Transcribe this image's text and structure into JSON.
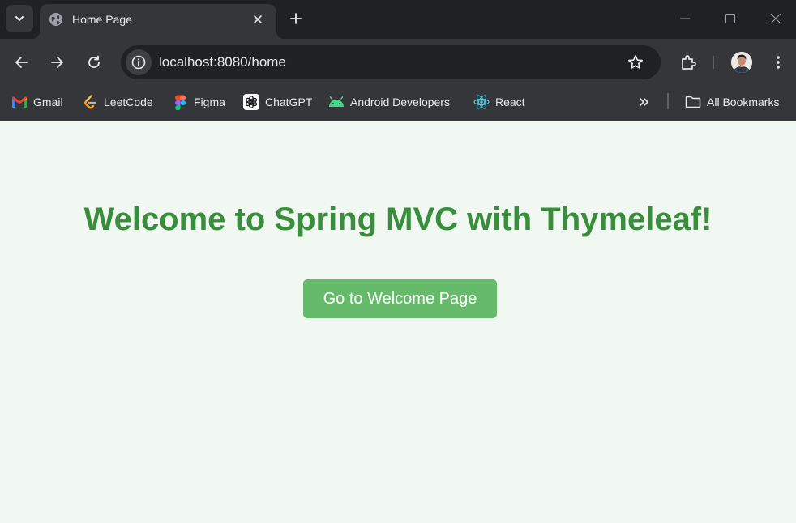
{
  "browser": {
    "tab": {
      "title": "Home Page",
      "favicon": "globe-icon"
    },
    "new_tab_icon": "plus-icon",
    "window_controls": [
      "minimize-icon",
      "maximize-icon",
      "close-icon"
    ],
    "address_bar": {
      "url": "localhost:8080/home",
      "site_info_icon": "info-icon",
      "bookmark_icon": "star-icon"
    }
  },
  "bookmarks": {
    "items": [
      {
        "label": "Gmail",
        "icon": "gmail-icon"
      },
      {
        "label": "LeetCode",
        "icon": "leetcode-icon"
      },
      {
        "label": "Figma",
        "icon": "figma-icon"
      },
      {
        "label": "ChatGPT",
        "icon": "chatgpt-icon"
      },
      {
        "label": "Android Developers",
        "icon": "android-icon"
      },
      {
        "label": "React",
        "icon": "react-icon"
      }
    ],
    "all_bookmarks": {
      "label": "All Bookmarks",
      "icon": "folder-icon"
    }
  },
  "page": {
    "heading": "Welcome to Spring MVC with Thymeleaf!",
    "button_label": "Go to Welcome Page"
  },
  "colors": {
    "heading": "#388e3c",
    "button": "#66bb6a",
    "page_background": "#f1f8f1"
  }
}
